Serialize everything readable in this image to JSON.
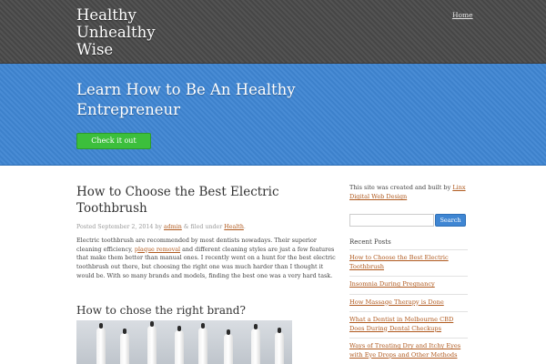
{
  "header": {
    "site_title_lines": [
      "Healthy",
      "Unhealthy",
      "Wise"
    ],
    "nav_home": "Home"
  },
  "banner": {
    "title": "Learn How to Be An Healthy Entrepreneur",
    "button_label": "Check it out"
  },
  "post": {
    "title": "How to Choose the Best Electric Toothbrush",
    "meta": {
      "posted_prefix": "Posted September 2, 2014 by ",
      "author": "admin",
      "filed_prefix": " & filed under ",
      "category": "Health",
      "suffix": "."
    },
    "body": {
      "text_before_link": "Electric toothbrush are recommended by most dentists nowadays. Their superior cleaning efficiency, ",
      "link_text": "plaque removal",
      "text_after_link": " and different cleaning styles are just a few features that make them better than manual ones. I recently went on a hunt for the best electric toothbrush out there, but choosing the right one was much harder than I thought it would be. With so many brands and models, finding the best one was a very hard task."
    },
    "subheading": "How to chose the right brand?"
  },
  "sidebar": {
    "credit_text": "This site was created and built by ",
    "credit_link": "Linx Digital Web Design",
    "search": {
      "placeholder": "",
      "button_label": "Search"
    },
    "recent_posts_heading": "Recent Posts",
    "recent_posts": [
      "How to Choose the Best Electric Toothbrush",
      "Insomnia During Pregnancy",
      "How Massage Therapy is Done",
      "What a Dentist in Melbourne CBD Does During Dental Checkups",
      "Ways of Treating Dry and Itchy Eyes with Eye Drops and Other Methods"
    ]
  },
  "colors": {
    "header_bg": "#4a4a4a",
    "banner_bg": "#3f86d3",
    "button_green": "#3cbf3c",
    "link_color": "#b05a1f"
  }
}
